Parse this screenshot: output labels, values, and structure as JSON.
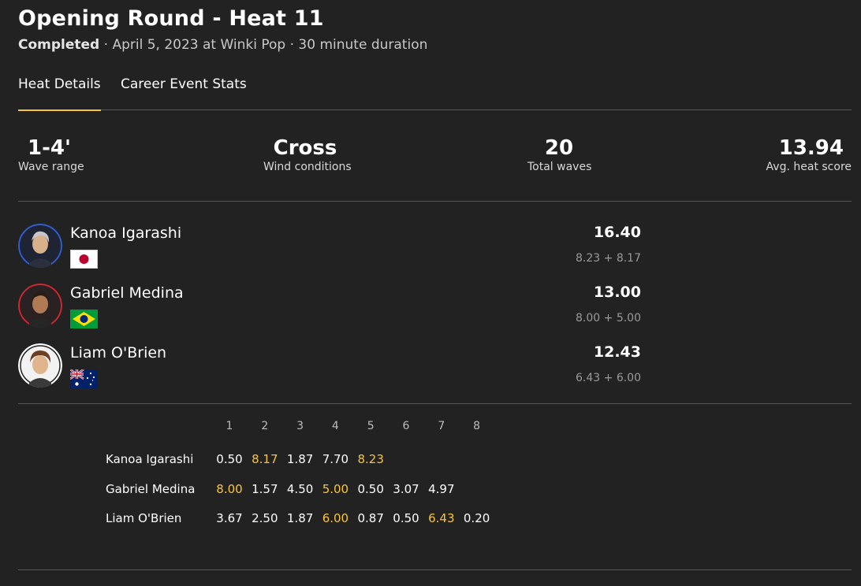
{
  "header": {
    "title": "Opening Round - Heat 11",
    "status": "Completed",
    "details": " · April 5, 2023 at Winki Pop · 30 minute duration"
  },
  "tabs": [
    {
      "label": "Heat Details",
      "active": true
    },
    {
      "label": "Career Event Stats",
      "active": false
    }
  ],
  "stats": [
    {
      "value": "1-4'",
      "label": "Wave range"
    },
    {
      "value": "Cross",
      "label": "Wind conditions"
    },
    {
      "value": "20",
      "label": "Total waves"
    },
    {
      "value": "13.94",
      "label": "Avg. heat score"
    }
  ],
  "surfers": [
    {
      "name": "Kanoa Igarashi",
      "flag": "japan-flag",
      "ring_color": "#2f5fd0",
      "total": "16.40",
      "combo": "8.23 + 8.17"
    },
    {
      "name": "Gabriel Medina",
      "flag": "brazil-flag",
      "ring_color": "#d0282f",
      "total": "13.00",
      "combo": "8.00 + 5.00"
    },
    {
      "name": "Liam O'Brien",
      "flag": "australia-flag",
      "ring_color": "#ffffff",
      "total": "12.43",
      "combo": "6.43 + 6.00"
    }
  ],
  "waves": {
    "headers": [
      "1",
      "2",
      "3",
      "4",
      "5",
      "6",
      "7",
      "8"
    ],
    "rows": [
      {
        "name": "Kanoa Igarashi",
        "scores": [
          "0.50",
          "8.17",
          "1.87",
          "7.70",
          "8.23"
        ],
        "best": [
          1,
          4
        ]
      },
      {
        "name": "Gabriel Medina",
        "scores": [
          "8.00",
          "1.57",
          "4.50",
          "5.00",
          "0.50",
          "3.07",
          "4.97"
        ],
        "best": [
          0,
          3
        ]
      },
      {
        "name": "Liam O'Brien",
        "scores": [
          "3.67",
          "2.50",
          "1.87",
          "6.00",
          "0.87",
          "0.50",
          "6.43",
          "0.20"
        ],
        "best": [
          3,
          6
        ]
      }
    ]
  },
  "colors": {
    "accent": "#f7c43b",
    "background": "#222222"
  }
}
